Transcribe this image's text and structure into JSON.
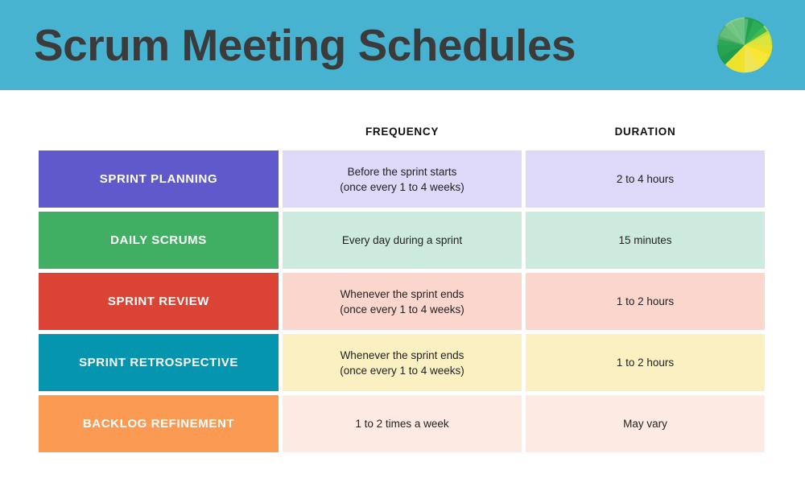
{
  "header": {
    "title": "Scrum Meeting Schedules",
    "band_color": "#47b3d1",
    "title_color": "#3b3b3b",
    "logo_name": "pinwheel-flower-logo"
  },
  "table": {
    "columns": [
      {
        "key": "meeting",
        "label": ""
      },
      {
        "key": "frequency",
        "label": "FREQUENCY"
      },
      {
        "key": "duration",
        "label": "DURATION"
      }
    ],
    "rows": [
      {
        "meeting": "SPRINT PLANNING",
        "frequency_line1": "Before the sprint starts",
        "frequency_line2": "(once every 1 to 4 weeks)",
        "duration": "2 to 4 hours",
        "label_color": "#6059cb",
        "cell_color": "#ded9f9"
      },
      {
        "meeting": "DAILY SCRUMS",
        "frequency_line1": "Every day during a sprint",
        "frequency_line2": "",
        "duration": "15 minutes",
        "label_color": "#41af63",
        "cell_color": "#cdeade"
      },
      {
        "meeting": "SPRINT REVIEW",
        "frequency_line1": "Whenever the sprint ends",
        "frequency_line2": "(once every 1 to 4 weeks)",
        "duration": "1 to 2 hours",
        "label_color": "#db4435",
        "cell_color": "#fbd6cd"
      },
      {
        "meeting": "SPRINT RETROSPECTIVE",
        "frequency_line1": "Whenever the sprint ends",
        "frequency_line2": "(once every 1 to 4 weeks)",
        "duration": "1 to 2 hours",
        "label_color": "#0595af",
        "cell_color": "#fbf0c2"
      },
      {
        "meeting": "BACKLOG REFINEMENT",
        "frequency_line1": "1 to 2 times a week",
        "frequency_line2": "",
        "duration": "May vary",
        "label_color": "#fb9a53",
        "cell_color": "#fdebe3"
      }
    ]
  }
}
